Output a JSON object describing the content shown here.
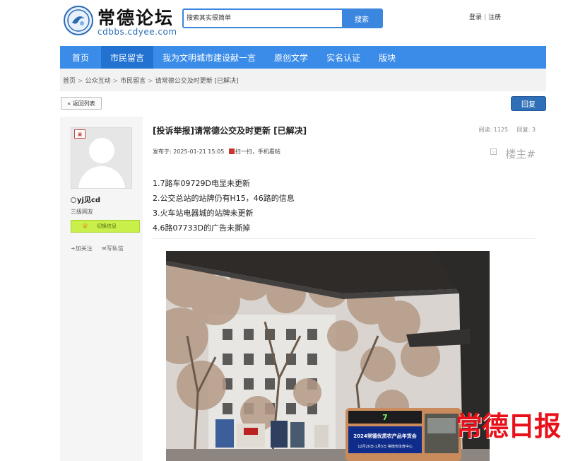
{
  "header": {
    "logo_title": "常德论坛",
    "logo_url": "cdbbs.cdyee.com",
    "search_placeholder": "搜索其实很简单",
    "search_button": "搜索",
    "login": "登录",
    "register": "注册"
  },
  "nav": [
    {
      "label": "首页",
      "active": false
    },
    {
      "label": "市民留言",
      "active": true
    },
    {
      "label": "我为文明城市建设献一言",
      "active": false
    },
    {
      "label": "原创文学",
      "active": false
    },
    {
      "label": "实名认证",
      "active": false
    },
    {
      "label": "版块",
      "active": false
    }
  ],
  "breadcrumb": [
    "首页",
    "公众互动",
    "市民留言",
    "请常德公交及时更新 [已解决]"
  ],
  "buttons": {
    "back": "« 返回列表",
    "reply": "回复"
  },
  "user": {
    "name": "yj见cd",
    "level": "三级网友",
    "level_bar_text": "切换信息",
    "follow": "加关注",
    "message": "写私信"
  },
  "post": {
    "title": "[投诉举报]请常德公交及时更新 [已解决]",
    "views_label": "阅读:",
    "views": "1125",
    "replies_label": "回复:",
    "replies": "3",
    "posted_label": "发布于:",
    "posted_at": "2025-01-21 15:05",
    "scan_text": "扫一扫，手机看帖",
    "floor": "楼主#",
    "lines": [
      "1.7路车09729D电显未更新",
      "2.公交总站的站牌仍有H15，46路的信息",
      "3.火车站电器城的站牌未更新",
      "4.6路07733D的广告未撕掉"
    ]
  },
  "photo": {
    "bus_sign_route": "7",
    "bus_banner_line1": "2024常德优质农产品年货会",
    "bus_banner_line2": "12月20日-1月5日 常德市体育中心"
  },
  "watermark": "常德日报",
  "colors": {
    "nav_blue": "#3b8ce8",
    "nav_active": "#2272d1",
    "reply_button": "#2f6fb8",
    "watermark_red": "#e8111a"
  }
}
